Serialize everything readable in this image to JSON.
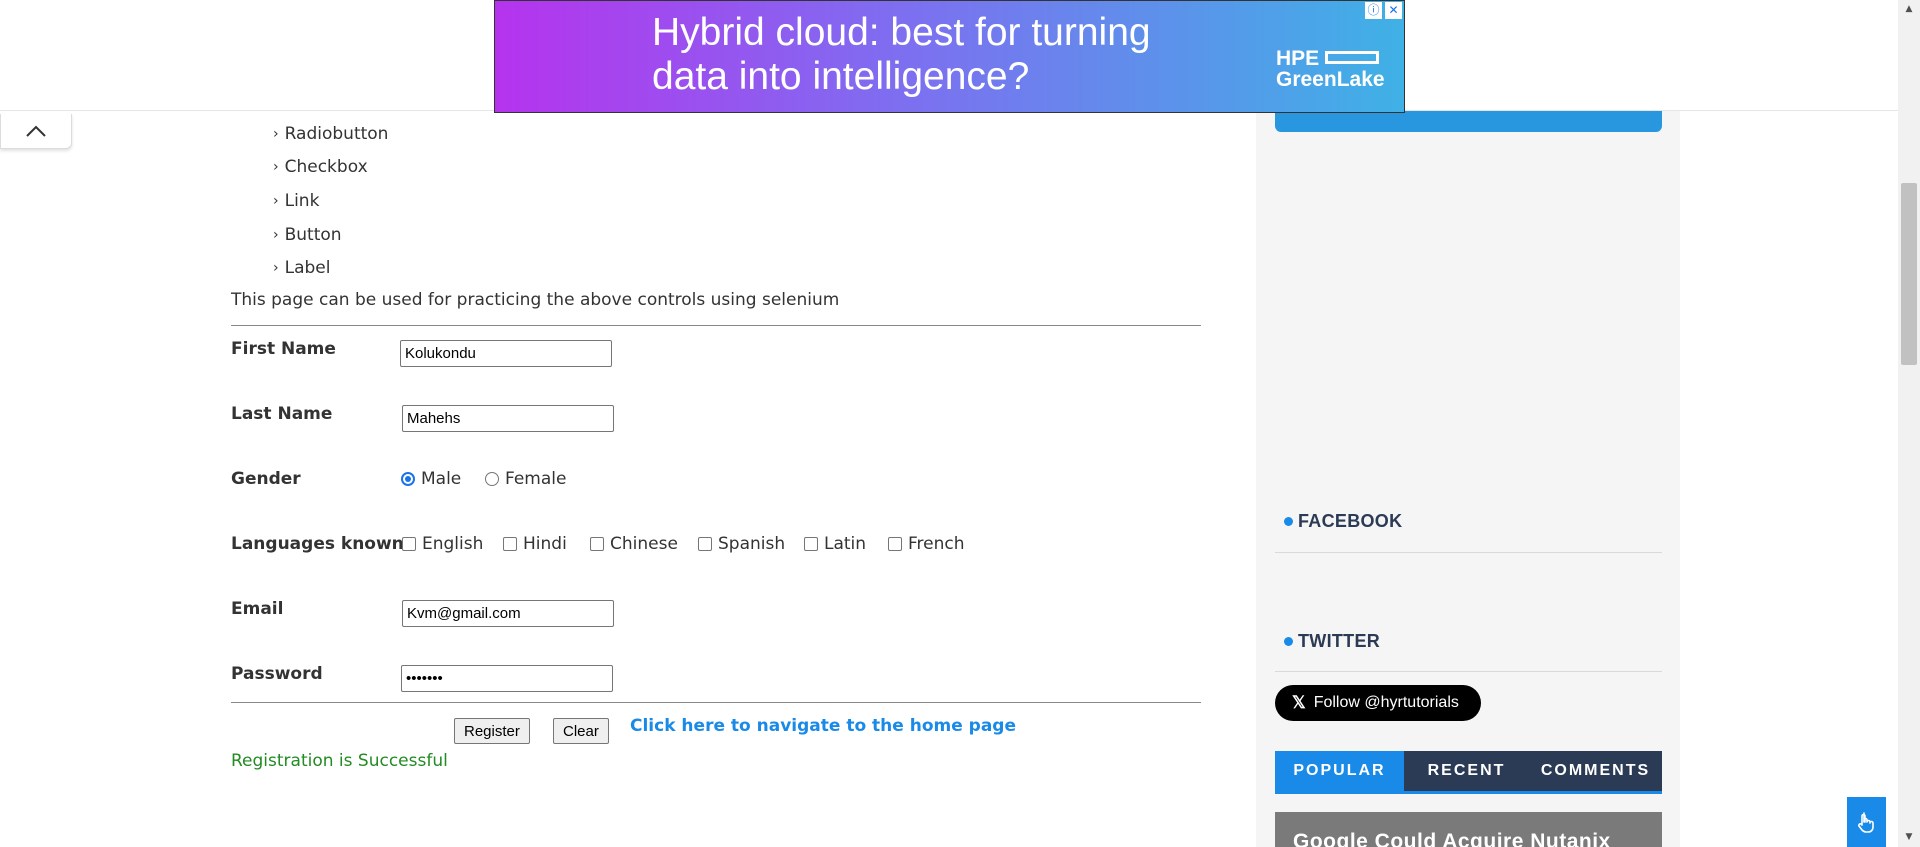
{
  "ad": {
    "headline": "Hybrid cloud: best for turning data into intelligence?",
    "brand_line1": "HPE",
    "brand_line2": "GreenLake",
    "info_icon": "info-icon",
    "close_icon": "close-icon"
  },
  "scroll_top_icon": "chevron-up-icon",
  "controls_list": [
    {
      "label": "Radiobutton"
    },
    {
      "label": "Checkbox"
    },
    {
      "label": "Link"
    },
    {
      "label": "Button"
    },
    {
      "label": "Label"
    }
  ],
  "description": "This page can be used for practicing the above controls using selenium",
  "form": {
    "first_name": {
      "label": "First Name",
      "value": "Kolukondu"
    },
    "last_name": {
      "label": "Last Name",
      "value": "Mahehs"
    },
    "gender": {
      "label": "Gender",
      "options": [
        "Male",
        "Female"
      ],
      "selected": "Male"
    },
    "languages": {
      "label": "Languages known",
      "options": [
        "English",
        "Hindi",
        "Chinese",
        "Spanish",
        "Latin",
        "French"
      ],
      "checked": []
    },
    "email": {
      "label": "Email",
      "value": "Kvm@gmail.com"
    },
    "password": {
      "label": "Password",
      "value": "•••••••"
    },
    "register_label": "Register",
    "clear_label": "Clear",
    "home_link": "Click here to navigate to the home page",
    "status_message": "Registration is Successful"
  },
  "sidebar": {
    "facebook_heading": "FACEBOOK",
    "twitter_heading": "TWITTER",
    "follow_label": "Follow @hyrtutorials",
    "tabs": [
      {
        "label": "POPULAR",
        "active": true
      },
      {
        "label": "RECENT",
        "active": false
      },
      {
        "label": "COMMENTS",
        "active": false
      }
    ],
    "post_title": "Google Could Acquire Nutanix"
  },
  "colors": {
    "accent": "#1a8ae8",
    "sidebar_dark": "#2b3a55",
    "success": "#228b22"
  },
  "float_icon": "hand-pointer-icon"
}
